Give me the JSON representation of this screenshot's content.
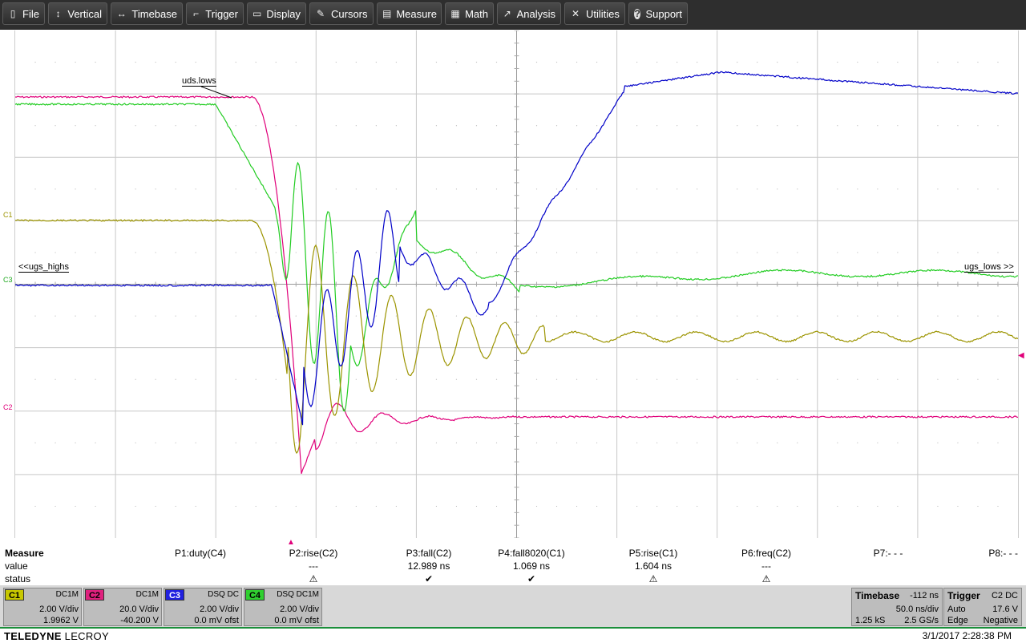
{
  "menu": [
    {
      "label": "File",
      "icon": "file-icon"
    },
    {
      "label": "Vertical",
      "icon": "vertical-icon"
    },
    {
      "label": "Timebase",
      "icon": "timebase-icon"
    },
    {
      "label": "Trigger",
      "icon": "trigger-icon"
    },
    {
      "label": "Display",
      "icon": "display-icon"
    },
    {
      "label": "Cursors",
      "icon": "cursors-icon"
    },
    {
      "label": "Measure",
      "icon": "measure-icon"
    },
    {
      "label": "Math",
      "icon": "math-icon"
    },
    {
      "label": "Analysis",
      "icon": "analysis-icon"
    },
    {
      "label": "Utilities",
      "icon": "utilities-icon"
    },
    {
      "label": "Support",
      "icon": "support-icon"
    }
  ],
  "colors": {
    "c1": "#9c9400",
    "c2": "#e0007a",
    "c3": "#0000c8",
    "c4": "#22cc22",
    "c1_tag": "#c8c800",
    "c2_tag": "#e0207e",
    "c3_tag": "#2020e0",
    "c4_tag": "#30d030"
  },
  "grid_labels": {
    "uds_lows": "uds.lows",
    "ugs_highs": "<<ugs_highs",
    "ugs_lows": "ugs_lows >>",
    "c1_marker": "C1",
    "c2_marker": "C2",
    "c3_marker": "C3"
  },
  "measure": {
    "title": "Measure",
    "row_value": "value",
    "row_status": "status",
    "params": [
      {
        "name": "P1:duty(C4)",
        "value": "",
        "status": ""
      },
      {
        "name": "P2:rise(C2)",
        "value": "---",
        "status": "⚠"
      },
      {
        "name": "P3:fall(C2)",
        "value": "12.989 ns",
        "status": "✔"
      },
      {
        "name": "P4:fall8020(C1)",
        "value": "1.069 ns",
        "status": "✔"
      },
      {
        "name": "P5:rise(C1)",
        "value": "1.604 ns",
        "status": "⚠"
      },
      {
        "name": "P6:freq(C2)",
        "value": "---",
        "status": "⚠"
      },
      {
        "name": "P7:- - -",
        "value": "",
        "status": ""
      },
      {
        "name": "P8:- - -",
        "value": "",
        "status": ""
      }
    ]
  },
  "channels": [
    {
      "tag": "C1",
      "coupling": "DC1M",
      "vdiv": "2.00 V/div",
      "offset": "1.9962 V"
    },
    {
      "tag": "C2",
      "coupling": "DC1M",
      "vdiv": "20.0 V/div",
      "offset": "-40.200 V"
    },
    {
      "tag": "C3",
      "coupling": "DSQ  DC",
      "vdiv": "2.00 V/div",
      "offset": "0.0 mV ofst"
    },
    {
      "tag": "C4",
      "coupling": "DSQ  DC1M",
      "vdiv": "2.00 V/div",
      "offset": "0.0 mV ofst"
    }
  ],
  "timebase": {
    "title": "Timebase",
    "delay": "-112 ns",
    "tdiv": "50.0 ns/div",
    "samples": "1.25 kS",
    "rate": "2.5 GS/s"
  },
  "trigger": {
    "title": "Trigger",
    "source": "C2  DC",
    "mode": "Auto",
    "level": "17.6 V",
    "type": "Edge",
    "slope": "Negative"
  },
  "brand": {
    "bold": "TELEDYNE",
    "light": " LECROY"
  },
  "datetime": "3/1/2017 2:28:38 PM"
}
